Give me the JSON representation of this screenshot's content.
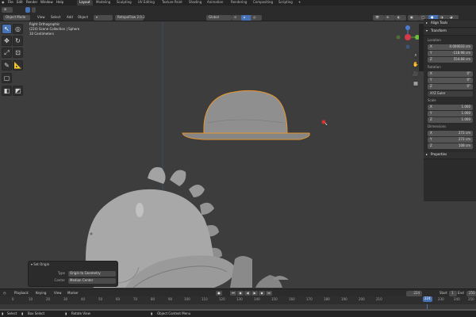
{
  "menubar": {
    "menus": [
      "File",
      "Edit",
      "Render",
      "Window",
      "Help"
    ],
    "tabs": [
      "Layout",
      "Modeling",
      "Sculpting",
      "UV Editing",
      "Texture Paint",
      "Shading",
      "Animation",
      "Rendering",
      "Compositing",
      "Scripting"
    ],
    "active_tab": "Layout"
  },
  "header": {
    "mode": "Object Mode",
    "menus": [
      "View",
      "Select",
      "Add",
      "Object"
    ],
    "orientation": "Global",
    "addon": "RetopoFlow 2.0.2"
  },
  "viewport": {
    "view_name": "Right Orthographic",
    "collection_line": "(224) Scene Collection | Sphere",
    "units_line": "10 Centimeters"
  },
  "sidebar": {
    "align_tools": "Align Tools",
    "transform": "Transform",
    "location_label": "Location",
    "location": [
      {
        "axis": "X",
        "value": "0.000033 cm"
      },
      {
        "axis": "Y",
        "value": "-118.98 cm"
      },
      {
        "axis": "Z",
        "value": "554.68 cm"
      }
    ],
    "rotation_label": "Rotation",
    "rotation": [
      {
        "axis": "X",
        "value": "0°"
      },
      {
        "axis": "Y",
        "value": "0°"
      },
      {
        "axis": "Z",
        "value": "0°"
      }
    ],
    "rotation_mode": "XYZ Euler",
    "scale_label": "Scale",
    "scale": [
      {
        "axis": "X",
        "value": "1.000"
      },
      {
        "axis": "Y",
        "value": "1.000"
      },
      {
        "axis": "Z",
        "value": "1.000"
      }
    ],
    "dimensions_label": "Dimensions",
    "dimensions": [
      {
        "axis": "X",
        "value": "272 cm"
      },
      {
        "axis": "Y",
        "value": "272 cm"
      },
      {
        "axis": "Z",
        "value": "108 cm"
      }
    ],
    "properties": "Properties"
  },
  "set_origin": {
    "title": "Set Origin",
    "type_label": "Type",
    "type_value": "Origin to Geometry",
    "center_label": "Center",
    "center_value": "Median Center"
  },
  "timeline": {
    "menus": [
      "Playback",
      "Keying",
      "View",
      "Marker"
    ],
    "current_frame": "224",
    "start_label": "Start",
    "start_value": "1",
    "end_label": "End",
    "end_value": "250",
    "ruler": [
      "0",
      "10",
      "20",
      "30",
      "40",
      "50",
      "60",
      "70",
      "80",
      "90",
      "100",
      "110",
      "120",
      "130",
      "140",
      "150",
      "160",
      "170",
      "180",
      "190",
      "200",
      "210",
      "224",
      "230",
      "240",
      "250"
    ],
    "playhead_frame": "224"
  },
  "statusbar": {
    "items": [
      "Select",
      "Box Select",
      "Rotate View",
      "Object Context Menu"
    ]
  },
  "colors": {
    "accent": "#4772b3",
    "selection_outline": "#e8952e",
    "background": "#3d3d3d"
  }
}
